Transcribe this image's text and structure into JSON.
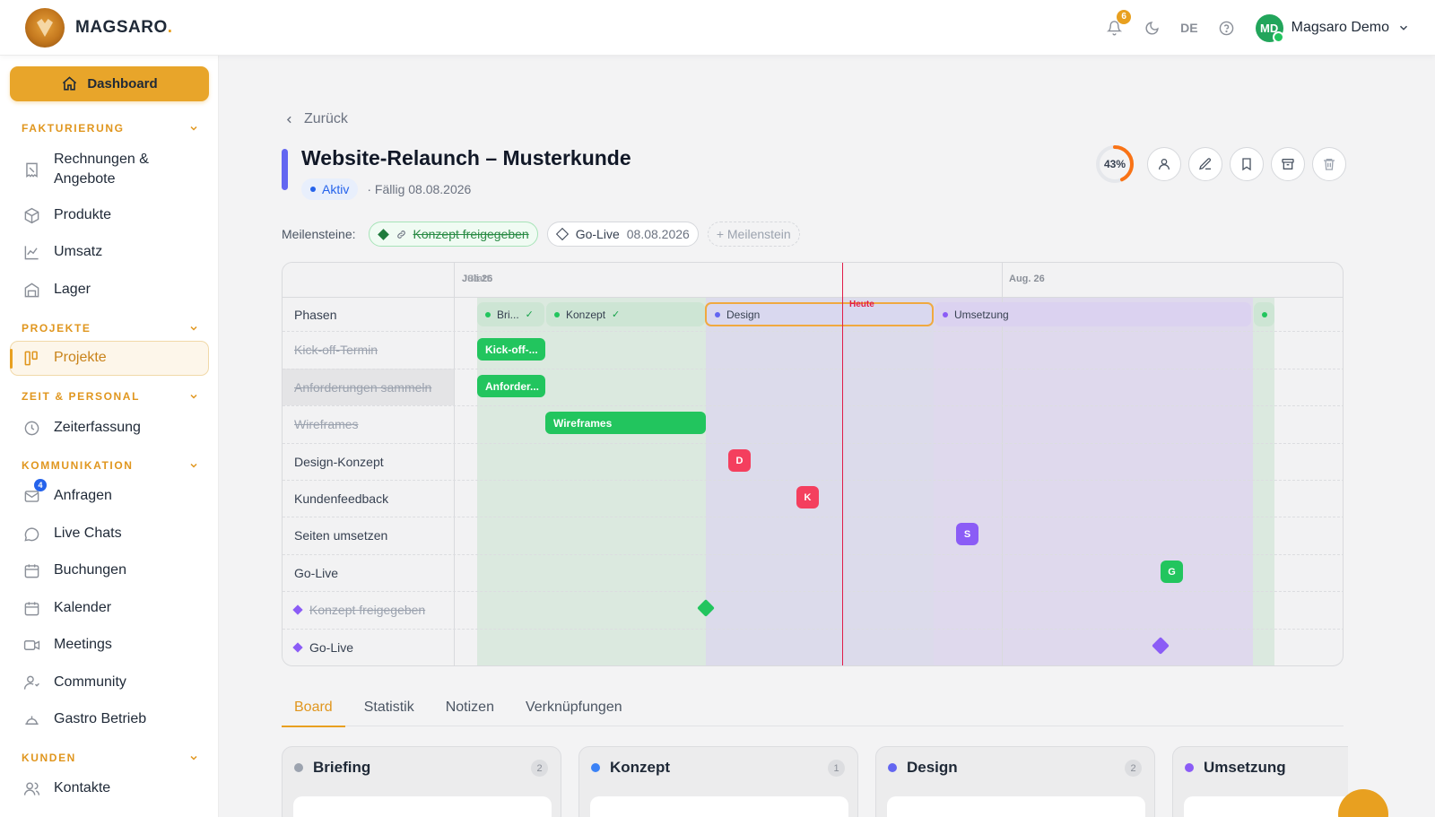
{
  "brand": {
    "name": "MAGSARO",
    "dot": "."
  },
  "header": {
    "notifications_count": "6",
    "language": "DE",
    "user_initials": "MD",
    "user_name": "Magsaro Demo"
  },
  "sidebar": {
    "dashboard": "Dashboard",
    "sections": {
      "fakturierung": "FAKTURIERUNG",
      "projekte": "PROJEKTE",
      "zeit": "ZEIT & PERSONAL",
      "kommunikation": "KOMMUNIKATION",
      "kunden": "KUNDEN"
    },
    "items": {
      "rechnungen_1": "Rechnungen &",
      "rechnungen_2": "Angebote",
      "produkte": "Produkte",
      "umsatz": "Umsatz",
      "lager": "Lager",
      "projekte": "Projekte",
      "zeiterfassung": "Zeiterfassung",
      "anfragen": "Anfragen",
      "anfragen_badge": "4",
      "live_chats": "Live Chats",
      "buchungen": "Buchungen",
      "kalender": "Kalender",
      "meetings": "Meetings",
      "community": "Community",
      "gastro": "Gastro Betrieb",
      "kontakte": "Kontakte"
    }
  },
  "project": {
    "back_label": "Zurück",
    "title": "Website-Relaunch – Musterkunde",
    "status": "Aktiv",
    "due": "· Fällig 08.08.2026",
    "progress_label": "43%",
    "progress_value": 0.43,
    "accent_color": "#6366f1"
  },
  "milestones": {
    "label": "Meilensteine:",
    "done": "Konzept freigegeben",
    "open_name": "Go-Live",
    "open_date": "08.08.2026",
    "add": "+ Meilenstein"
  },
  "gantt": {
    "month_start": "Juli 26",
    "start_label": "Start",
    "month_aug": "Aug. 26",
    "today_label": "Heute",
    "phases_label": "Phasen",
    "phases": {
      "briefing": "Bri...",
      "konzept": "Konzept",
      "design": "Design",
      "umsetzung": "Umsetzung"
    },
    "rows": {
      "kickoff": "Kick-off-Termin",
      "anforderungen": "Anforderungen sammeln",
      "wireframes": "Wireframes",
      "design_konzept": "Design-Konzept",
      "kundenfeedback": "Kundenfeedback",
      "seiten": "Seiten umsetzen",
      "golive": "Go-Live",
      "ms_konzept": "Konzept freigegeben",
      "ms_golive": "Go-Live"
    },
    "bars": {
      "kickoff": "Kick-off-...",
      "anforderungen": "Anforder...",
      "wireframes": "Wireframes"
    },
    "markers": {
      "d": "D",
      "k": "K",
      "s": "S",
      "g": "G"
    }
  },
  "tabs": [
    "Board",
    "Statistik",
    "Notizen",
    "Verknüpfungen"
  ],
  "board": [
    {
      "name": "Briefing",
      "count": "2",
      "color": "#9ca3af"
    },
    {
      "name": "Konzept",
      "count": "1",
      "color": "#3b82f6"
    },
    {
      "name": "Design",
      "count": "2",
      "color": "#6366f1"
    },
    {
      "name": "Umsetzung",
      "count": "",
      "color": "#8b5cf6"
    }
  ]
}
